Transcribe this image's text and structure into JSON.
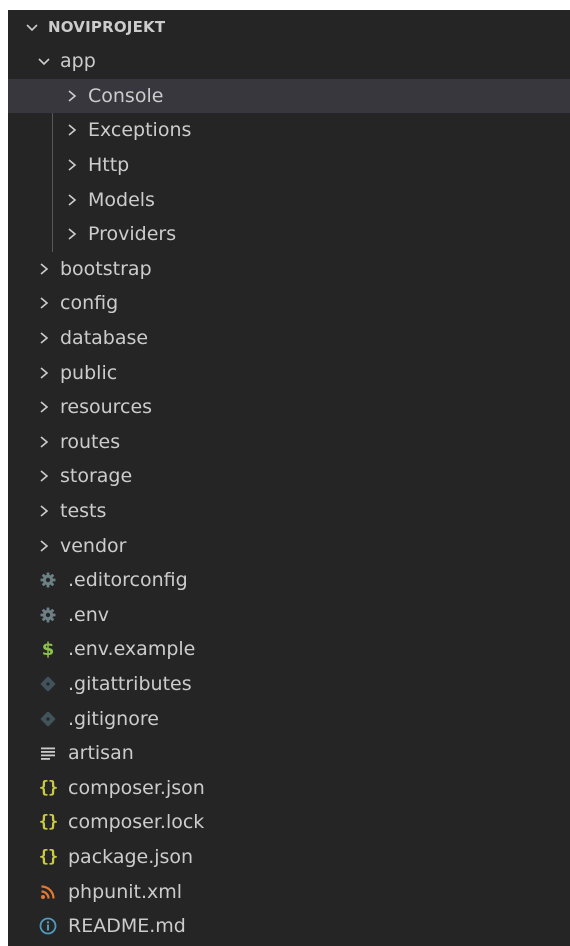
{
  "explorer": {
    "project_name": "NOVIPROJEKT",
    "colors": {
      "background": "#252526",
      "selected_row": "#37373d",
      "text": "#cccccc",
      "dollar_icon": "#8dc149",
      "braces_icon": "#cbcb41",
      "rss_icon": "#e37933",
      "info_icon": "#519aba",
      "gear_icon": "#6d8086",
      "git_icon": "#41535b"
    },
    "app_folder": {
      "name": "app",
      "children": [
        "Console",
        "Exceptions",
        "Http",
        "Models",
        "Providers"
      ],
      "selected": "Console"
    },
    "folders": [
      "bootstrap",
      "config",
      "database",
      "public",
      "resources",
      "routes",
      "storage",
      "tests",
      "vendor"
    ],
    "files": [
      {
        "name": ".editorconfig",
        "icon": "gear-icon"
      },
      {
        "name": ".env",
        "icon": "gear-icon"
      },
      {
        "name": ".env.example",
        "icon": "dollar-icon"
      },
      {
        "name": ".gitattributes",
        "icon": "git-icon"
      },
      {
        "name": ".gitignore",
        "icon": "git-icon"
      },
      {
        "name": "artisan",
        "icon": "lines-icon"
      },
      {
        "name": "composer.json",
        "icon": "braces-icon"
      },
      {
        "name": "composer.lock",
        "icon": "braces-icon"
      },
      {
        "name": "package.json",
        "icon": "braces-icon"
      },
      {
        "name": "phpunit.xml",
        "icon": "rss-icon"
      },
      {
        "name": "README.md",
        "icon": "info-icon"
      }
    ]
  }
}
